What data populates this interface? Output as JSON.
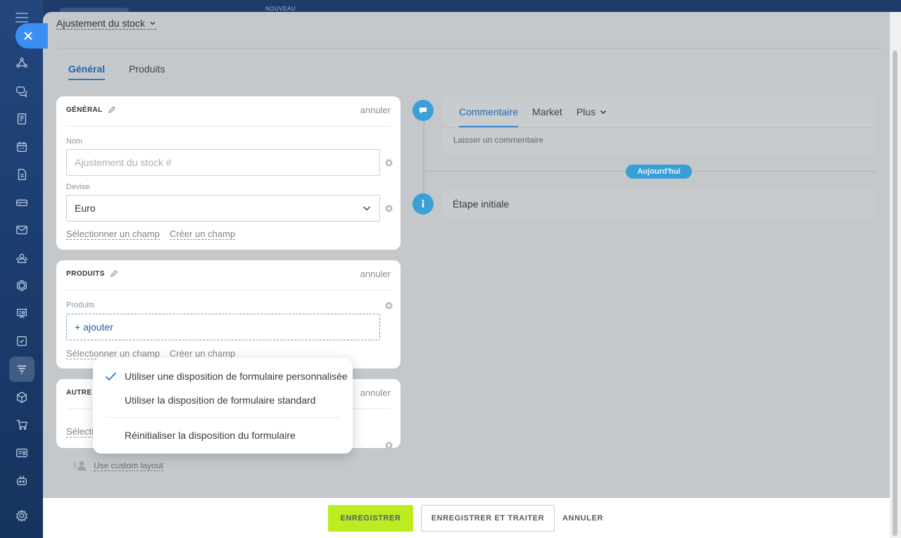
{
  "topbar": {
    "nouveau_label": "NOUVEAU"
  },
  "sidebar": {
    "icons": [
      "crm-icon",
      "chat-icon",
      "feed-icon",
      "calendar-icon",
      "document-icon",
      "inventory-icon",
      "mail-icon",
      "contacts-icon",
      "hexagon-icon",
      "presentation-icon",
      "task-icon",
      "funnel-icon",
      "package-icon",
      "cart-icon",
      "idcard-icon",
      "robot-icon",
      "settings-icon"
    ]
  },
  "header": {
    "title": "Ajustement du stock"
  },
  "tabs": [
    {
      "label": "Général",
      "active": true
    },
    {
      "label": "Produits",
      "active": false
    }
  ],
  "general_card": {
    "title": "GÉNÉRAL",
    "cancel": "annuler",
    "name_label": "Nom",
    "name_placeholder": "Ajustement du stock #",
    "currency_label": "Devise",
    "currency_value": "Euro",
    "select_field": "Sélectionner un champ",
    "create_field": "Créer un champ"
  },
  "products_card": {
    "title": "PRODUITS",
    "cancel": "annuler",
    "products_label": "Produits",
    "add_label": "+ ajouter",
    "select_field": "Sélectionner un champ",
    "create_field": "Créer un champ"
  },
  "other_card": {
    "title": "AUTRE",
    "cancel": "annuler",
    "select_field_partial": "Sélecti"
  },
  "custom_layout_link": "Use custom layout",
  "timeline": {
    "tabs": [
      {
        "label": "Commentaire",
        "active": true
      },
      {
        "label": "Market",
        "active": false
      },
      {
        "label": "Plus",
        "active": false
      }
    ],
    "comment_placeholder": "Laisser un commentaire",
    "today_badge": "Aujourd'hui",
    "initial_step": "Étape initiale"
  },
  "popup": {
    "items": [
      {
        "label": "Utiliser une disposition de formulaire personnalisée",
        "checked": true
      },
      {
        "label": "Utiliser la disposition de formulaire standard",
        "checked": false
      },
      {
        "label": "Réinitialiser la disposition du formulaire",
        "checked": false
      }
    ]
  },
  "footer": {
    "save": "ENREGISTRER",
    "save_and_process": "ENREGISTRER ET TRAITER",
    "cancel": "ANNULER"
  },
  "colors": {
    "accent": "#2f7bc4",
    "save_button": "#bbed21",
    "timeline_icon": "#3aa0d8",
    "close_button": "#3b8ff2"
  }
}
